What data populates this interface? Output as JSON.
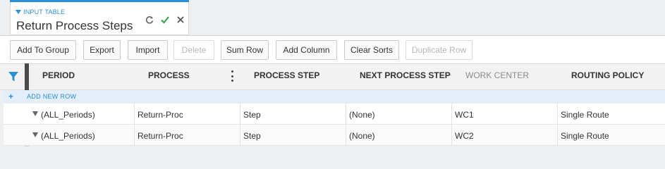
{
  "header": {
    "type_label": "INPUT TABLE",
    "title": "Return Process Steps",
    "icons": [
      "refresh-icon",
      "check-icon",
      "close-icon"
    ]
  },
  "toolbar": {
    "add_to_group": "Add To Group",
    "export": "Export",
    "import": "Import",
    "delete": "Delete",
    "sum_row": "Sum Row",
    "add_column": "Add Column",
    "clear_sorts": "Clear Sorts",
    "duplicate_row": "Duplicate Row"
  },
  "grid": {
    "columns": {
      "period": "PERIOD",
      "process": "PROCESS",
      "process_step": "PROCESS STEP",
      "next_process_step": "NEXT PROCESS STEP",
      "work_center": "WORK CENTER",
      "routing_policy": "ROUTING POLICY"
    },
    "add_new_row": "ADD NEW ROW",
    "rows": [
      {
        "period": "(ALL_Periods)",
        "process": "Return-Proc",
        "process_step": "Step",
        "next_process_step": "(None)",
        "work_center": "WC1",
        "routing_policy": "Single Route"
      },
      {
        "period": "(ALL_Periods)",
        "process": "Return-Proc",
        "process_step": "Step",
        "next_process_step": "(None)",
        "work_center": "WC2",
        "routing_policy": "Single Route"
      }
    ]
  },
  "colors": {
    "accent": "#2a8fd6",
    "confirm": "#2e9e48"
  }
}
